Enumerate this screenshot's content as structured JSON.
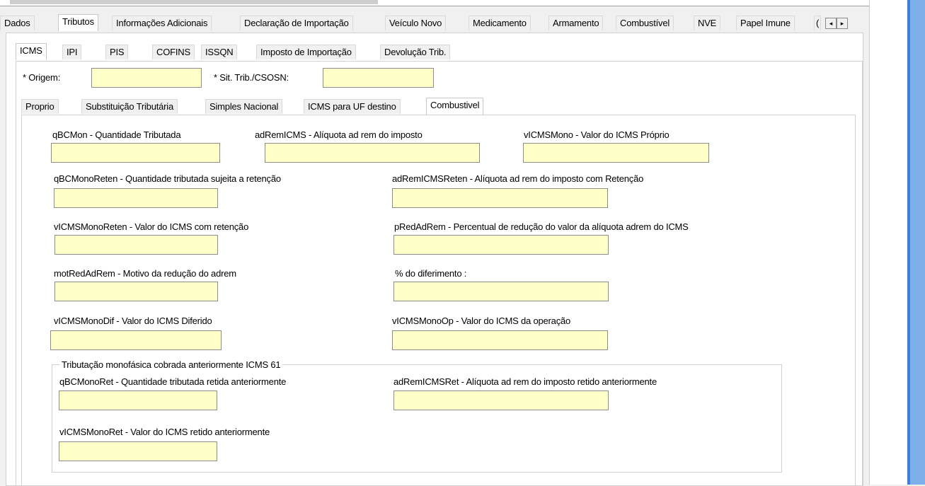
{
  "top_tabs": [
    "Dados",
    "Tributos",
    "Informações Adicionais",
    "Declaração de Importação",
    "Veículo Novo",
    "Medicamento",
    "Armamento",
    "Combustível",
    "NVE",
    "Papel Imune",
    "("
  ],
  "top_tabs_active": "Tributos",
  "scroll_left_glyph": "◂",
  "scroll_right_glyph": "▸",
  "tax_tabs": [
    "ICMS",
    "IPI",
    "PIS",
    "COFINS",
    "ISSQN",
    "Imposto de Importação",
    "Devolução Trib."
  ],
  "tax_tabs_active": "ICMS",
  "origem_label": "* Origem:",
  "origem_value": "",
  "sit_trib_label": "* Sit. Trib./CSOSN:",
  "sit_trib_value": "",
  "icms_tabs": [
    "Proprio",
    "Substituição Tributária",
    "Simples Nacional",
    "ICMS para UF destino",
    "Combustivel"
  ],
  "icms_tabs_active": "Combustivel",
  "fields": {
    "qBCMon": {
      "label": "qBCMon - Quantidade Tributada",
      "value": ""
    },
    "adRemICMS": {
      "label": "adRemICMS - Alíquota ad rem do imposto",
      "value": ""
    },
    "vICMSMono": {
      "label": "vICMSMono - Valor do ICMS Próprio",
      "value": ""
    },
    "qBCMonoReten": {
      "label": "qBCMonoReten - Quantidade tributada sujeita a retenção",
      "value": ""
    },
    "adRemICMSReten": {
      "label": "adRemICMSReten - Alíquota ad rem do imposto com Retenção",
      "value": ""
    },
    "vICMSMonoReten": {
      "label": "vICMSMonoReten - Valor do ICMS com retenção",
      "value": ""
    },
    "pRedAdRem": {
      "label": "pRedAdRem - Percentual de redução do valor da alíquota adrem do ICMS",
      "value": ""
    },
    "motRedAdRem": {
      "label": "motRedAdRem - Motivo da redução do adrem",
      "value": ""
    },
    "pDif": {
      "label": "% do diferimento :",
      "value": ""
    },
    "vICMSMonoDif": {
      "label": "vICMSMonoDif - Valor do ICMS Diferido",
      "value": ""
    },
    "vICMSMonoOp": {
      "label": "vICMSMonoOp - Valor do ICMS da operação",
      "value": ""
    }
  },
  "group_icms61": {
    "legend": "Tributação monofásica cobrada anteriormente ICMS 61",
    "qBCMonoRet": {
      "label": "qBCMonoRet - Quantidade tributada retida anteriormente",
      "value": ""
    },
    "adRemICMSRet": {
      "label": "adRemICMSRet - Alíquota ad rem do imposto retido anteriormente",
      "value": ""
    },
    "vICMSMonoRet": {
      "label": "vICMSMonoRet - Valor do ICMS retido anteriormente",
      "value": ""
    }
  },
  "colors": {
    "field_bg": "#ffffc8",
    "panel_bg": "#ffffff",
    "window_bg": "#f0f0f0",
    "accent_blue": "#3c7fd8"
  }
}
